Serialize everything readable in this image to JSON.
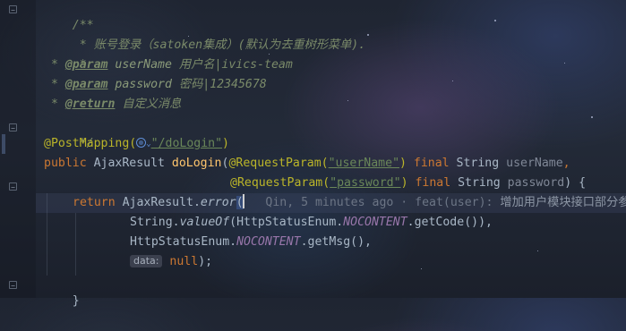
{
  "theme": {
    "comment": "#7a8a69",
    "annotation": "#bbb529",
    "keyword": "#cc7832",
    "method": "#ffc66d",
    "string": "#6a8759",
    "constant": "#9876aa",
    "plain": "#a9b7c6"
  },
  "code": {
    "doc_open": "/**",
    "doc_summary": " * 账号登录（satoken集成）(默认为去重树形菜单).",
    "doc_blank": " *",
    "doc_star": " * ",
    "param_tag": "@param",
    "param1_name": " userName",
    "param1_desc": " 用户名|ivics-team",
    "param2_name": " password",
    "param2_desc": " 密码|12345678",
    "return_tag": "@return",
    "return_desc": " 自定义消息",
    "doc_close": " */",
    "post_mapping": "@PostMapping(",
    "mapping_value": "\"/doLogin\"",
    "close_paren": ")",
    "kw_public": "public",
    "return_type": " AjaxResult ",
    "method_name": "doLogin",
    "open_paren": "(",
    "request_param": "@RequestParam(",
    "arg1_name": "\"userName\"",
    "arg2_name": "\"password\"",
    "kw_final": " final",
    "type_string": " String",
    "param_username": " userName",
    "param_password": " password",
    "comma": ",",
    "open_brace": ") {",
    "kw_return": "return",
    "ajax_error_prefix": " AjaxResult.",
    "error_method": "error",
    "error_open": "(",
    "blame_author": "Qin, 5 minutes ago · feat(user): ",
    "blame_message": "增加用户模块接口部分参",
    "string_class": "String.",
    "value_of": "valueOf",
    "http_enum": "HttpStatusEnum.",
    "nocontent": "NOCONTENT",
    "get_code": ".getCode()),",
    "get_msg": ".getMsg(),",
    "param_hint": "data:",
    "null_kw": " null",
    "end_stmt": ");",
    "close_brace": "}"
  },
  "gutter": {
    "fold_icon": "fold-minus-icon"
  }
}
